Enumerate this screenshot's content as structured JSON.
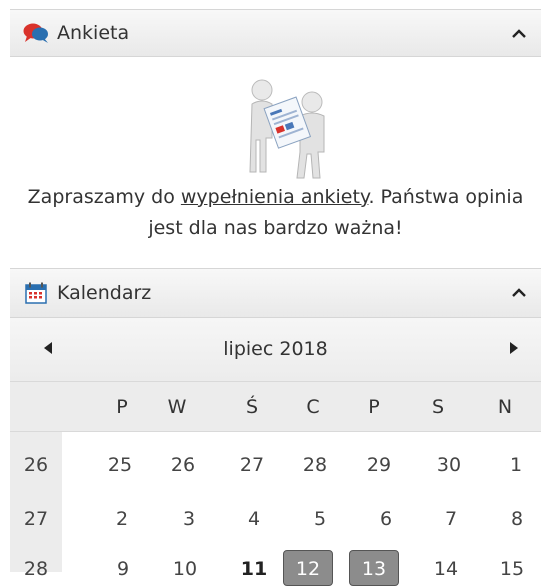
{
  "survey": {
    "title": "Ankieta",
    "text_before": "Zapraszamy do ",
    "link_text": "wypełnienia ankiety",
    "text_after": ". Państwa opinia jest dla nas bardzo ważna!",
    "header_icon": "speech-bubbles-icon",
    "collapse_icon": "chevron-up-icon"
  },
  "calendar": {
    "title": "Kalendarz",
    "header_icon": "calendar-icon",
    "collapse_icon": "chevron-up-icon",
    "month_label": "lipiec 2018",
    "weekdays": [
      "P",
      "W",
      "Ś",
      "C",
      "P",
      "S",
      "N"
    ],
    "weeks": [
      {
        "week": "26",
        "days": [
          "25",
          "26",
          "27",
          "28",
          "29",
          "30",
          "1"
        ]
      },
      {
        "week": "27",
        "days": [
          "2",
          "3",
          "4",
          "5",
          "6",
          "7",
          "8"
        ]
      },
      {
        "week": "28",
        "days": [
          "9",
          "10",
          "11",
          "12",
          "13",
          "14",
          "15"
        ]
      }
    ],
    "today": "11",
    "highlighted_days": [
      "12",
      "13"
    ]
  },
  "colors": {
    "header_bg": "#ececec",
    "highlight_bg": "#8c8c8c",
    "icon_red": "#d9322b",
    "icon_blue": "#2a6fb0"
  }
}
